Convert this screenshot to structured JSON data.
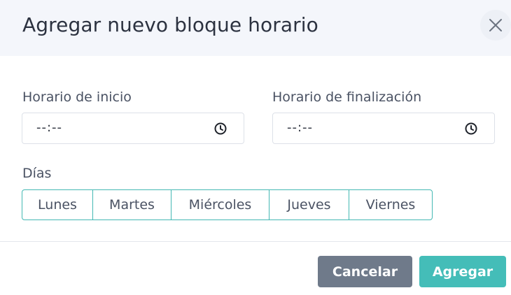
{
  "modal": {
    "title": "Agregar nuevo bloque horario",
    "close_icon": "close-icon"
  },
  "form": {
    "start_time": {
      "label": "Horario de inicio",
      "value": "--:--",
      "icon": "clock-icon"
    },
    "end_time": {
      "label": "Horario de finalización",
      "value": "--:--",
      "icon": "clock-icon"
    },
    "days": {
      "label": "Días",
      "options": [
        "Lunes",
        "Martes",
        "Miércoles",
        "Jueves",
        "Viernes"
      ]
    }
  },
  "footer": {
    "cancel_label": "Cancelar",
    "submit_label": "Agregar"
  },
  "colors": {
    "header_bg": "#f4f6fb",
    "accent_teal": "#44bdb8",
    "cancel_gray": "#6f7a8a",
    "input_border": "#dde1e8"
  }
}
